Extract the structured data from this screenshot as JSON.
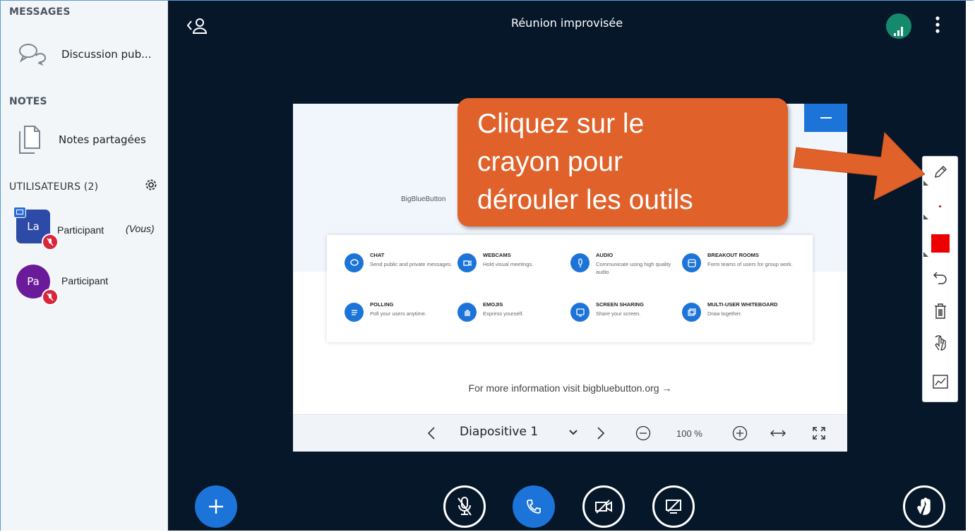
{
  "sidebar": {
    "messages_title": "MESSAGES",
    "public_chat_label": "Discussion pub...",
    "notes_title": "NOTES",
    "shared_notes_label": "Notes partagées",
    "users_title": "UTILISATEURS (2)",
    "users": [
      {
        "initials": "La",
        "name": "Participant",
        "you_label": "(Vous)",
        "color": "#2d4aa6"
      },
      {
        "initials": "Pa",
        "name": "Participant",
        "color": "#6a1b9a"
      }
    ]
  },
  "header": {
    "title": "Réunion improvisée"
  },
  "slide": {
    "brand_text": "BigBlueButton",
    "features": [
      {
        "title": "CHAT",
        "desc": "Send public and private messages.",
        "icon": "chat-icon"
      },
      {
        "title": "WEBCAMS",
        "desc": "Hold visual meetings.",
        "icon": "webcam-icon"
      },
      {
        "title": "AUDIO",
        "desc": "Communicate using high quality audio.",
        "icon": "mic-icon"
      },
      {
        "title": "BREAKOUT ROOMS",
        "desc": "Form teams of users for group work.",
        "icon": "rooms-icon"
      },
      {
        "title": "POLLING",
        "desc": "Poll your users anytime.",
        "icon": "poll-icon"
      },
      {
        "title": "EMOJIS",
        "desc": "Express yourself.",
        "icon": "hand-icon"
      },
      {
        "title": "SCREEN SHARING",
        "desc": "Share your screen.",
        "icon": "screen-icon"
      },
      {
        "title": "MULTI-USER WHITEBOARD",
        "desc": "Draw together.",
        "icon": "whiteboard-icon"
      }
    ],
    "more_info": "For more information visit bigbluebutton.org →"
  },
  "slide_toolbar": {
    "slide_label": "Diapositive 1",
    "zoom": "100 %"
  },
  "callout": {
    "line1": "Cliquez sur le",
    "line2": "crayon pour",
    "line3": "dérouler les outils"
  },
  "colors": {
    "main_bg": "#06172a",
    "accent": "#1c74d9",
    "callout": "#e0612a",
    "connection": "#14896b",
    "mute": "#d9263b",
    "color_swatch": "#ee0000"
  }
}
